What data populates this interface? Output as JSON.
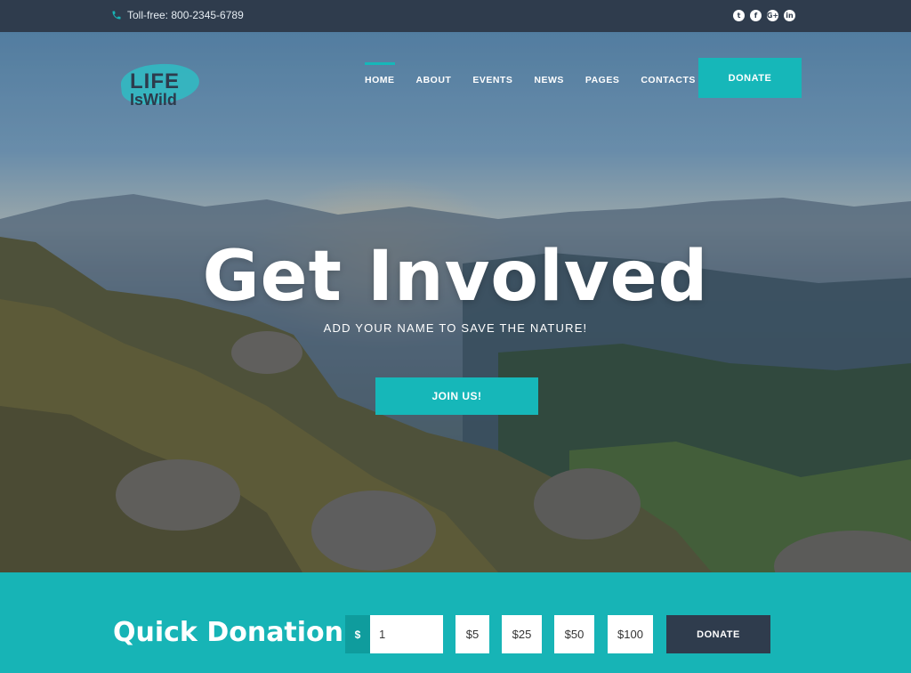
{
  "topbar": {
    "phone": "Toll-free: 800-2345-6789",
    "social_icons": [
      "twitter-icon",
      "facebook-icon",
      "google-plus-icon",
      "linkedin-icon"
    ],
    "social_glyphs": [
      "t",
      "f",
      "G+",
      "in"
    ]
  },
  "logo": {
    "line1": "LIFE",
    "line2": "IsWild"
  },
  "nav": {
    "items": [
      {
        "label": "HOME",
        "active": true
      },
      {
        "label": "ABOUT",
        "active": false
      },
      {
        "label": "EVENTS",
        "active": false
      },
      {
        "label": "NEWS",
        "active": false
      },
      {
        "label": "PAGES",
        "active": false
      },
      {
        "label": "CONTACTS",
        "active": false
      }
    ],
    "donate_label": "DONATE"
  },
  "hero": {
    "title": "Get Involved",
    "subtitle": "ADD YOUR NAME TO SAVE THE NATURE!",
    "cta_label": "JOIN US!"
  },
  "donation": {
    "heading": "Quick Donation",
    "currency_symbol": "$",
    "amount_value": "1",
    "presets": [
      "$5",
      "$25",
      "$50",
      "$100"
    ],
    "submit_label": "DONATE"
  },
  "colors": {
    "accent": "#16b7b9",
    "dark": "#2f3c4d",
    "donation_band": "#17b4b6"
  }
}
